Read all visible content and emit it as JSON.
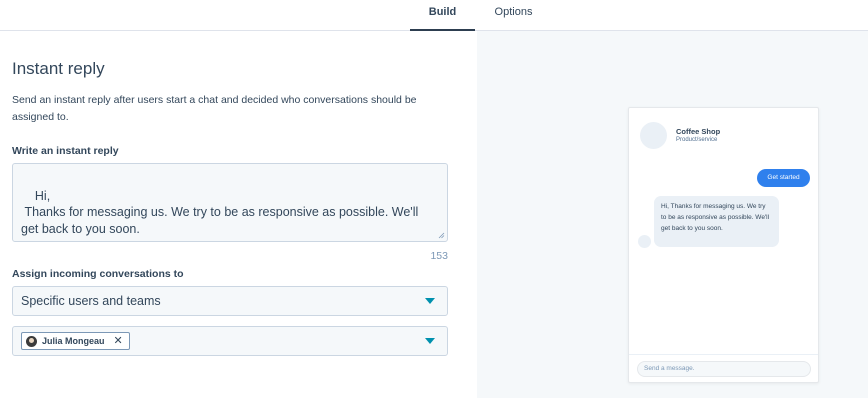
{
  "tabs": [
    {
      "label": "Build",
      "active": true
    },
    {
      "label": "Options",
      "active": false
    }
  ],
  "form": {
    "title": "Instant reply",
    "description": "Send an instant reply after users start a chat and decided who conversations should be assigned to.",
    "reply_label": "Write an instant reply",
    "reply_value": "Hi,\n Thanks for messaging us. We try to be as responsive as possible. We'll get back to you soon.",
    "char_count": "153",
    "assign_label": "Assign incoming conversations to",
    "assign_value": "Specific users and teams",
    "assignees": [
      {
        "name": "Julia Mongeau"
      }
    ]
  },
  "preview": {
    "company_name": "Coffee Shop",
    "company_type": "Product/service",
    "cta_label": "Get started",
    "bot_message": "Hi, Thanks for messaging us. We try to be as responsive as possible. We'll get back to you soon.",
    "input_placeholder": "Send a message."
  },
  "colors": {
    "accent": "#0091ae",
    "cta": "#2f80ed",
    "active_tab_underline": "#2d3e50",
    "preview_bg": "#f5f8fa"
  },
  "icons": {
    "dropdown": "caret-down-icon",
    "remove": "close-icon",
    "resize": "resize-grip-icon"
  }
}
